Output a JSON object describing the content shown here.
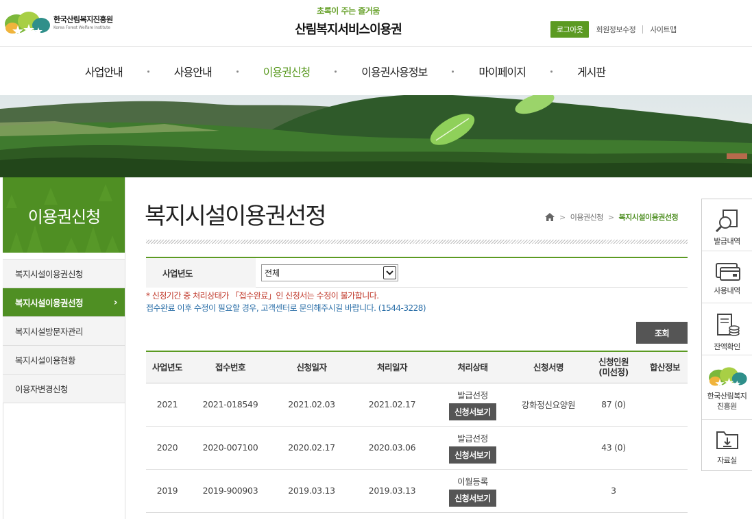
{
  "header": {
    "logo_ko": "한국산림복지진흥원",
    "logo_en": "Korea Forest Welfare Institute",
    "site_sub": "초록이 주는 즐거움",
    "site_title": "산림복지서비스이용권",
    "logout": "로그아웃",
    "edit_profile": "회원정보수정",
    "sitemap": "사이트맵"
  },
  "gnb": [
    {
      "label": "사업안내"
    },
    {
      "label": "사용안내"
    },
    {
      "label": "이용권신청"
    },
    {
      "label": "이용권사용정보"
    },
    {
      "label": "마이페이지"
    },
    {
      "label": "게시판"
    }
  ],
  "lnb": {
    "title": "이용권신청",
    "items": [
      {
        "label": "복지시설이용권신청"
      },
      {
        "label": "복지시설이용권선정"
      },
      {
        "label": "복지시설방문자관리"
      },
      {
        "label": "복지시설이용현황"
      },
      {
        "label": "이용자변경신청"
      }
    ],
    "active_arrow": "›"
  },
  "page": {
    "title": "복지시설이용권선정",
    "breadcrumb": [
      "이용권신청",
      "복지시설이용권선정"
    ],
    "bc_sep": ">"
  },
  "search": {
    "label": "사업년도",
    "selected": "전체",
    "button": "조회"
  },
  "notice": {
    "line1": "* 신청기간 중 처리상태가 「접수완료」인 신청서는 수정이 불가합니다.",
    "line2": "접수완료 이후 수정이 필요할 경우, 고객센터로 문의해주시길 바랍니다. (1544-3228)"
  },
  "table": {
    "headers": [
      "사업년도",
      "접수번호",
      "신청일자",
      "처리일자",
      "처리상태",
      "신청서명",
      "신청인원\n(미선정)",
      "합산정보"
    ],
    "header_count_1": "신청인원",
    "header_count_2": "(미선정)",
    "view_button": "신청서보기",
    "rows": [
      {
        "year": "2021",
        "no": "2021-018549",
        "apply_date": "2021.02.03",
        "process_date": "2021.02.17",
        "status": "발급선정",
        "name": "강화정신요양원",
        "count": "87 (0)",
        "sum": ""
      },
      {
        "year": "2020",
        "no": "2020-007100",
        "apply_date": "2020.02.17",
        "process_date": "2020.03.06",
        "status": "발급선정",
        "name": "",
        "count": "43 (0)",
        "sum": ""
      },
      {
        "year": "2019",
        "no": "2019-900903",
        "apply_date": "2019.03.13",
        "process_date": "2019.03.13",
        "status": "이월등록",
        "name": "",
        "count": "3",
        "sum": ""
      }
    ]
  },
  "quick": [
    {
      "label": "발급내역",
      "icon": "magnifier-document-icon"
    },
    {
      "label": "사용내역",
      "icon": "card-icon"
    },
    {
      "label": "잔액확인",
      "icon": "receipt-coins-icon"
    },
    {
      "label1": "한국산림복지",
      "label2": "진흥원",
      "icon": "logo-icon"
    },
    {
      "label": "자료실",
      "icon": "folder-download-icon"
    }
  ],
  "colors": {
    "brand_green": "#5b9a22",
    "lnb_green": "#4f8f23",
    "notice_red": "#c0392b",
    "notice_blue": "#2b6fa8"
  }
}
